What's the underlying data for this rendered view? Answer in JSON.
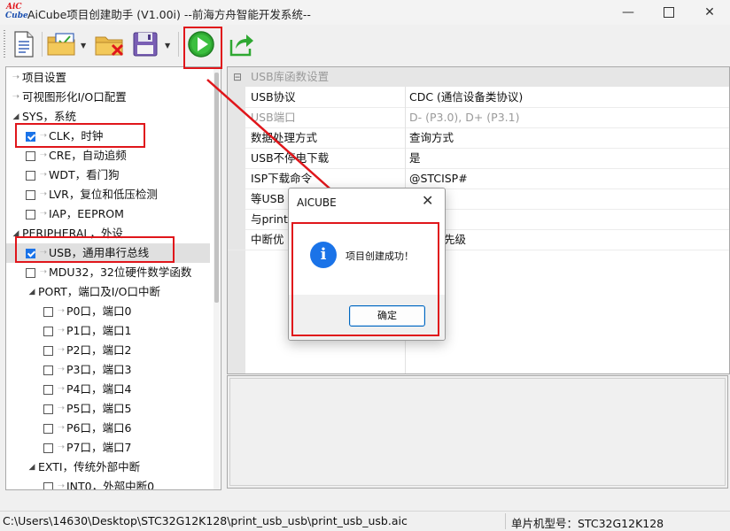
{
  "window": {
    "app_logo": {
      "line1": "AiC",
      "line2": "Cube"
    },
    "title": "AiCube项目创建助手 (V1.00i) --前海方舟智能开发系统--",
    "controls": [
      "minimize-icon",
      "maximize-icon",
      "close-icon"
    ]
  },
  "toolbar": {
    "buttons": [
      "new-document-icon",
      "open-folder-icon",
      "delete-folder-icon",
      "save-disk-icon",
      "run-play-icon",
      "export-share-icon"
    ],
    "colors": {
      "play": "#2fa832",
      "highlight": "#e0161b"
    }
  },
  "tree": {
    "items": [
      {
        "label": "项目设置"
      },
      {
        "label": "可视图形化I/O口配置"
      },
      {
        "label": "SYS，系统"
      },
      {
        "label": "CLK，时钟",
        "checked": true
      },
      {
        "label": "CRE，自动追频",
        "checked": false
      },
      {
        "label": "WDT，看门狗",
        "checked": false
      },
      {
        "label": "LVR，复位和低压检测",
        "checked": false
      },
      {
        "label": "IAP，EEPROM",
        "checked": false
      },
      {
        "label": "PERIPHERAL，外设"
      },
      {
        "label": "USB，通用串行总线",
        "checked": true
      },
      {
        "label": "MDU32，32位硬件数学函数",
        "checked": false
      },
      {
        "label": "PORT，端口及I/O口中断"
      },
      {
        "label": "P0口，端口0",
        "checked": false
      },
      {
        "label": "P1口，端口1",
        "checked": false
      },
      {
        "label": "P2口，端口2",
        "checked": false
      },
      {
        "label": "P3口，端口3",
        "checked": false
      },
      {
        "label": "P4口，端口4",
        "checked": false
      },
      {
        "label": "P5口，端口5",
        "checked": false
      },
      {
        "label": "P6口，端口6",
        "checked": false
      },
      {
        "label": "P7口，端口7",
        "checked": false
      },
      {
        "label": "EXTI，传统外部中断"
      },
      {
        "label": "INT0，外部中断0",
        "checked": false
      }
    ]
  },
  "props": {
    "section": "USB库函数设置",
    "rows": [
      {
        "key": "USB协议",
        "value": "CDC (通信设备类协议)"
      },
      {
        "key": "USB端口",
        "value": "D- (P3.0), D+ (P3.1)"
      },
      {
        "key": "数据处理方式",
        "value": "查询方式"
      },
      {
        "key": "USB不停电下载",
        "value": "是"
      },
      {
        "key": "ISP下载命令",
        "value": "@STCISP#"
      },
      {
        "key": "等USB",
        "value": ""
      },
      {
        "key": "与print",
        "value": ""
      },
      {
        "key": "中断优",
        "value": "先级"
      }
    ]
  },
  "status": {
    "path": "C:\\Users\\14630\\Desktop\\STC32G12K128\\print_usb_usb\\print_usb_usb.aic",
    "chip": "单片机型号：STC32G12K128"
  },
  "dialog": {
    "title": "AICUBE",
    "message": "项目创建成功！",
    "ok_label": "确定"
  }
}
